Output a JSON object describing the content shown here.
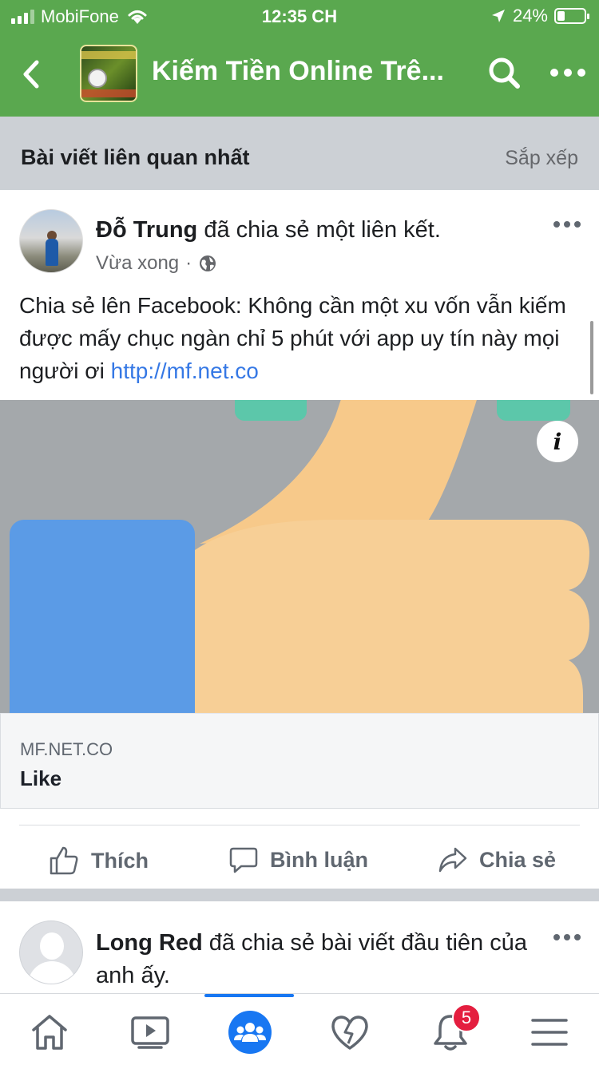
{
  "status_bar": {
    "carrier": "MobiFone",
    "time": "12:35 CH",
    "battery_percent": "24%"
  },
  "header": {
    "title": "Kiếm Tiền Online Trê...",
    "thumbnail_icon": "group-cover-image",
    "icons": [
      "back-chevron-icon",
      "search-icon",
      "more-icon"
    ]
  },
  "sort_bar": {
    "label": "Bài viết liên quan nhất",
    "sort": "Sắp xếp"
  },
  "post": {
    "author": "Đỗ Trung",
    "action": " đã chia sẻ một liên kết.",
    "time": "Vừa xong",
    "separator": "·",
    "text": "Chia sẻ lên Facebook: Không cần một xu vốn vẫn kiếm được mấy chục ngàn chỉ 5 phút với app uy tín này mọi người ơi ",
    "link": "http://mf.net.co",
    "info_icon_label": "i",
    "link_card": {
      "domain": "MF.NET.CO",
      "title": "Like"
    },
    "actions": {
      "like": "Thích",
      "comment": "Bình luận",
      "share": "Chia sẻ"
    }
  },
  "post2": {
    "author": "Long Red",
    "action": " đã chia sẻ bài viết đầu tiên của anh ấy."
  },
  "tabbar": {
    "tabs": [
      "home-icon",
      "watch-icon",
      "groups-icon",
      "dating-heart-icon",
      "notifications-icon",
      "menu-icon"
    ],
    "active": "groups-icon",
    "notification_count": "5"
  },
  "colors": {
    "header_green": "#5aa84f",
    "link_blue": "#3578e5",
    "active_blue": "#1877f2",
    "badge_red": "#e41e3f",
    "thumb_skin": "#f7c98a",
    "thumb_blue": "#5b9be6",
    "cuff_green": "#5cc7aa"
  }
}
